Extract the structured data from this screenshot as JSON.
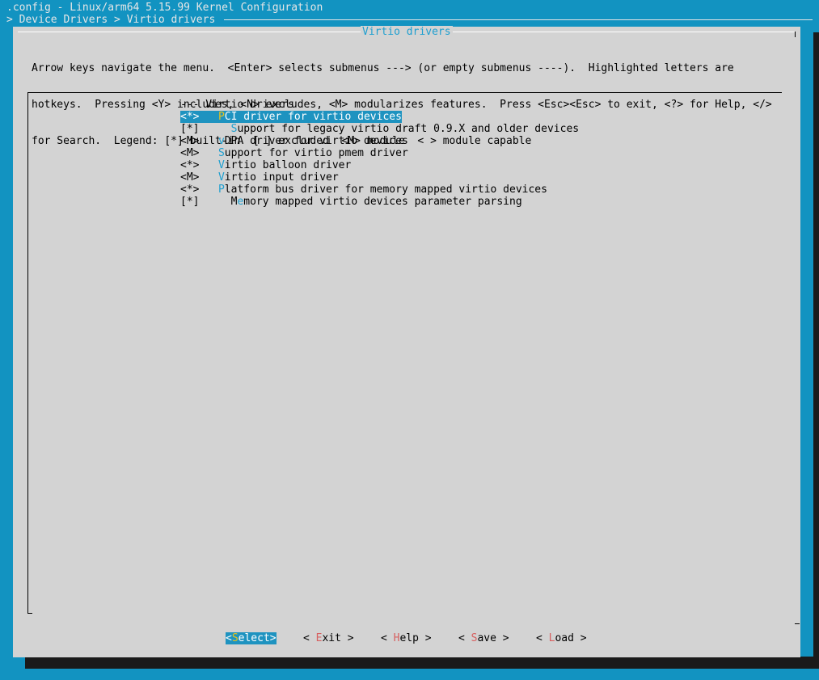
{
  "header": {
    "title": ".config - Linux/arm64 5.15.99 Kernel Configuration",
    "breadcrumb": "> Device Drivers > Virtio drivers"
  },
  "dialog": {
    "title": "Virtio drivers",
    "help_lines": [
      "Arrow keys navigate the menu.  <Enter> selects submenus ---> (or empty submenus ----).  Highlighted letters are",
      "hotkeys.  Pressing <Y> includes, <N> excludes, <M> modularizes features.  Press <Esc><Esc> to exit, <?> for Help, </>",
      "for Search.  Legend: [*] built-in  [ ] excluded  <M> module  < > module capable"
    ]
  },
  "menu": {
    "heading": "--- Virtio drivers",
    "items": [
      {
        "state": "<*>",
        "indent": "   ",
        "hotkey": "P",
        "rest": "CI driver for virtio devices",
        "selected": true
      },
      {
        "state": "[*]",
        "indent": "     ",
        "hotkey": "S",
        "rest": "upport for legacy virtio draft 0.9.X and older devices",
        "selected": false
      },
      {
        "state": "<M>",
        "indent": "   ",
        "hotkey": "v",
        "rest": "DPA driver for virtio devices",
        "selected": false
      },
      {
        "state": "<M>",
        "indent": "   ",
        "hotkey": "S",
        "rest": "upport for virtio pmem driver",
        "selected": false
      },
      {
        "state": "<*>",
        "indent": "   ",
        "hotkey": "V",
        "rest": "irtio balloon driver",
        "selected": false
      },
      {
        "state": "<M>",
        "indent": "   ",
        "hotkey": "V",
        "rest": "irtio input driver",
        "selected": false
      },
      {
        "state": "<*>",
        "indent": "   ",
        "hotkey": "P",
        "rest": "latform bus driver for memory mapped virtio devices",
        "selected": false
      },
      {
        "state": "[*]",
        "indent": "     ",
        "prefix": "M",
        "hotkey": "e",
        "rest": "mory mapped virtio devices parameter parsing",
        "selected": false
      }
    ]
  },
  "buttons": {
    "select": {
      "open": "<",
      "hotkey": "S",
      "rest": "elect",
      "close": ">"
    },
    "exit": {
      "open": "< ",
      "hotkey": "E",
      "rest": "xit",
      "close": " >"
    },
    "help": {
      "open": "< ",
      "hotkey": "H",
      "rest": "elp",
      "close": " >"
    },
    "save": {
      "open": "< ",
      "hotkey": "S",
      "rest": "ave",
      "close": " >"
    },
    "load": {
      "open": "< ",
      "hotkey": "L",
      "rest": "oad",
      "close": " >"
    }
  },
  "colors": {
    "background": "#1293c1",
    "dialog": "#d3d3d3",
    "highlight": "#1e93c0",
    "hotkey_selected": "#e8c21c",
    "hotkey": "#1e9fd0",
    "button_hotkey": "#d75f5f"
  }
}
